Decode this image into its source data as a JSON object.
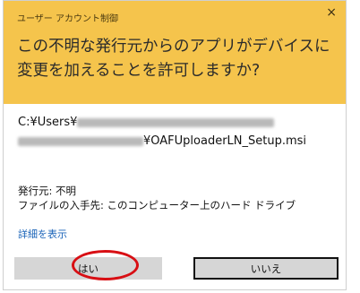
{
  "dialog": {
    "window_title": "ユーザー アカウント制御",
    "close_glyph": "×",
    "question": "この不明な発行元からのアプリがデバイスに変更を加えることを許可しますか?",
    "path_line1_prefix": "C:¥Users¥",
    "path_line2_suffix": "¥OAFUploaderLN_Setup.msi",
    "publisher": "発行元: 不明",
    "file_origin": "ファイルの入手先: このコンピューター上のハード ドライブ",
    "show_details": "詳細を表示",
    "yes_label": "はい",
    "no_label": "いいえ"
  },
  "colors": {
    "header_bg": "#f5c44c",
    "button_bg": "#d6d6d6",
    "link": "#1a63b8",
    "highlight_circle": "#d80f14"
  }
}
